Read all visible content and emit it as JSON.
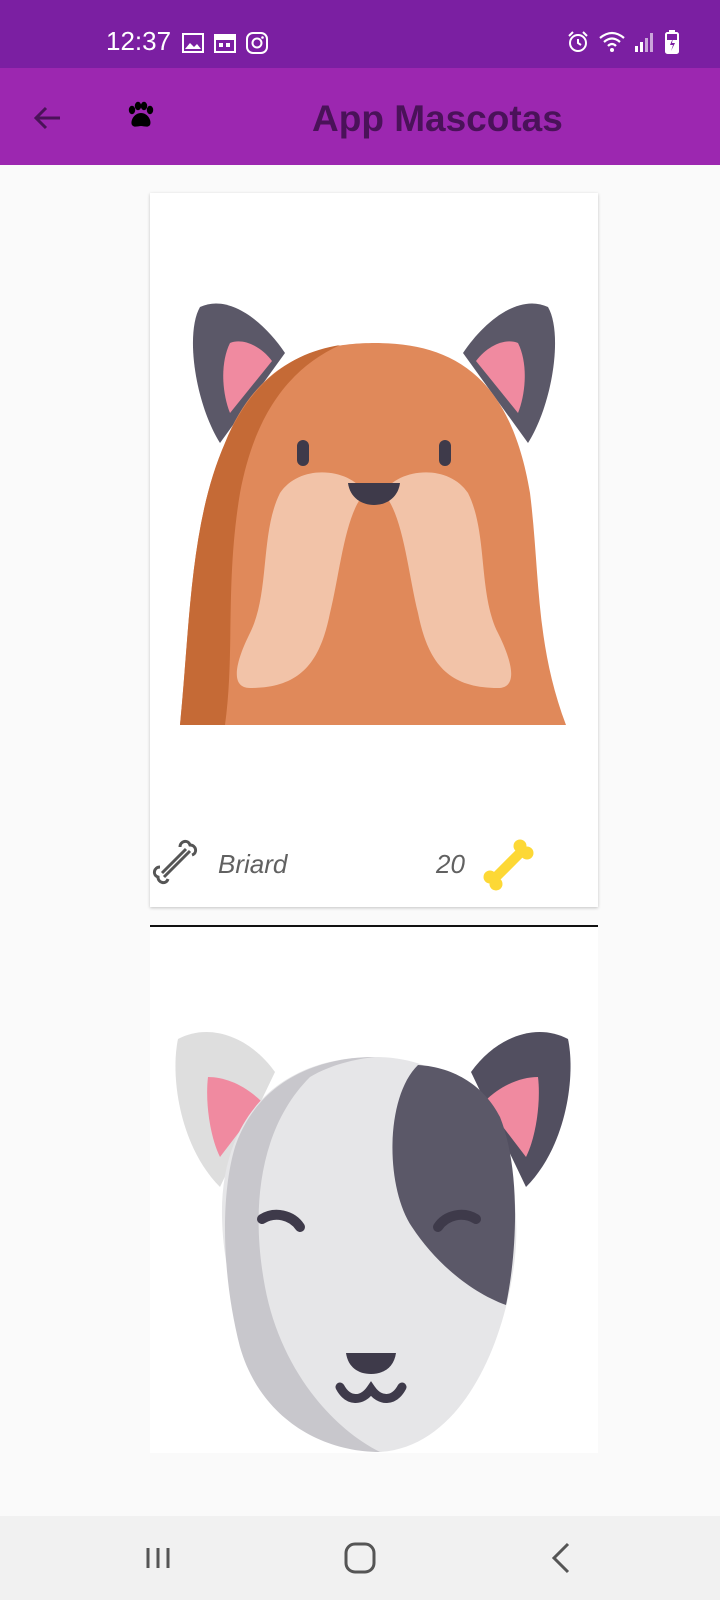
{
  "status_bar": {
    "time": "12:37",
    "left_icons": [
      "image-icon",
      "calendar-icon",
      "instagram-icon"
    ],
    "right_icons": [
      "alarm-icon",
      "wifi-icon",
      "signal-icon",
      "battery-charging-icon"
    ],
    "background": "#7b1fa2"
  },
  "app_bar": {
    "title": "App Mascotas",
    "back_icon": "arrow-back-icon",
    "logo_icon": "paw-icon",
    "background": "#9c27b0",
    "title_color": "#4a1259"
  },
  "pets": [
    {
      "name": "Briard",
      "rating": "20",
      "image": "dog-brown-mustache",
      "like_icon": "bone-outline-icon",
      "rating_icon": "bone-yellow-icon"
    },
    {
      "name": "",
      "rating": "",
      "image": "dog-bull-terrier",
      "like_icon": "",
      "rating_icon": ""
    }
  ],
  "nav_bar": {
    "buttons": [
      "recent-apps-icon",
      "home-icon",
      "back-icon"
    ]
  }
}
